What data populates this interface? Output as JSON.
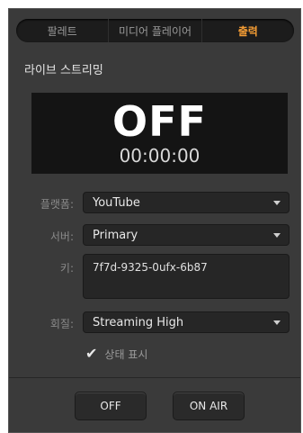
{
  "tabs": [
    {
      "label": "팔레트",
      "active": false
    },
    {
      "label": "미디어 플레이어",
      "active": false
    },
    {
      "label": "출력",
      "active": true
    }
  ],
  "section_title": "라이브 스트리밍",
  "status": {
    "word": "OFF",
    "time": "00:00:00"
  },
  "platform": {
    "label": "플랫폼:",
    "value": "YouTube"
  },
  "server": {
    "label": "서버:",
    "value": "Primary"
  },
  "key": {
    "label": "키:",
    "value": "7f7d-9325-0ufx-6b87"
  },
  "quality": {
    "label": "회질:",
    "value": "Streaming High"
  },
  "show_status": {
    "label": "상태 표시",
    "checked": true
  },
  "buttons": {
    "off": "OFF",
    "on_air": "ON AIR"
  },
  "colors": {
    "accent": "#f39c34",
    "panel": "#3a3a3a",
    "status_bg": "#141414"
  }
}
